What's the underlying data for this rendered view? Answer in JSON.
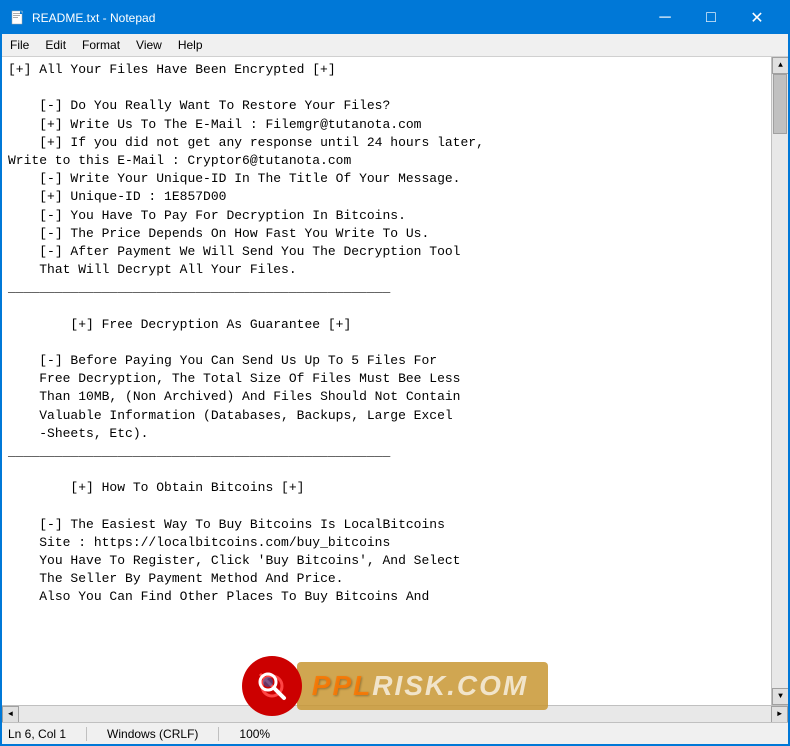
{
  "window": {
    "title": "README.txt - Notepad",
    "icon": "📄"
  },
  "titlebar": {
    "minimize_label": "─",
    "maximize_label": "□",
    "close_label": "✕"
  },
  "menubar": {
    "items": [
      "File",
      "Edit",
      "Format",
      "View",
      "Help"
    ]
  },
  "content": "[+] All Your Files Have Been Encrypted [+]\n\n    [-] Do You Really Want To Restore Your Files?\n    [+] Write Us To The E-Mail : Filemgr@tutanota.com\n    [+] If you did not get any response until 24 hours later,\nWrite to this E-Mail : Cryptor6@tutanota.com\n    [-] Write Your Unique-ID In The Title Of Your Message.\n    [+] Unique-ID : 1E857D00\n    [-] You Have To Pay For Decryption In Bitcoins.\n    [-] The Price Depends On How Fast You Write To Us.\n    [-] After Payment We Will Send You The Decryption Tool\n    That Will Decrypt All Your Files.\n_________________________________________________\n\n        [+] Free Decryption As Guarantee [+]\n\n    [-] Before Paying You Can Send Us Up To 5 Files For\n    Free Decryption, The Total Size Of Files Must Bee Less\n    Than 10MB, (Non Archived) And Files Should Not Contain\n    Valuable Information (Databases, Backups, Large Excel\n    -Sheets, Etc).\n_________________________________________________\n\n        [+] How To Obtain Bitcoins [+]\n\n    [-] The Easiest Way To Buy Bitcoins Is LocalBitcoins\n    Site : https://localbitcoins.com/buy_bitcoins\n    You Have To Register, Click 'Buy Bitcoins', And Select\n    The Seller By Payment Method And Price.\n    Also You Can Find Other Places To Buy Bitcoins And",
  "statusbar": {
    "position": "Ln 6, Col 1",
    "encoding": "Windows (CRLF)",
    "zoom": "100%"
  },
  "watermark": {
    "text": "RISK.COM"
  }
}
